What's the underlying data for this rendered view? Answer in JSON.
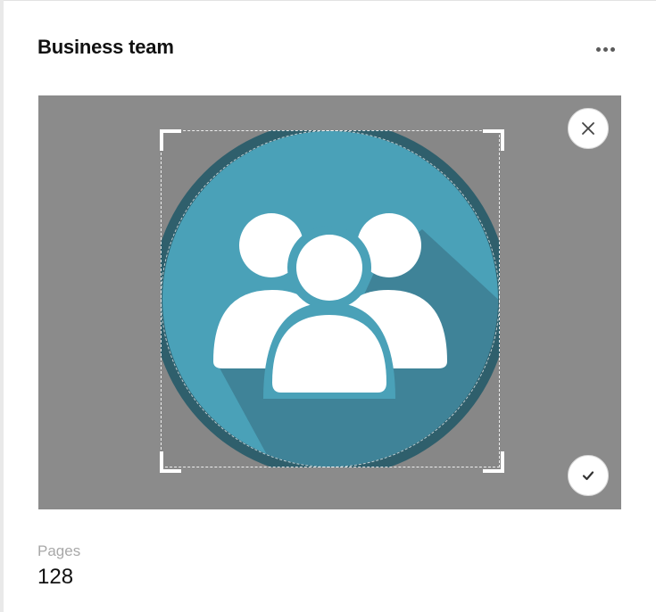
{
  "panel": {
    "title": "Business team",
    "more_icon": "more-horizontal-icon"
  },
  "editor": {
    "image": "team-group-icon",
    "close_icon": "close-icon",
    "confirm_icon": "check-icon",
    "colors": {
      "backdrop": "#8b8b8b",
      "circle": "#4aa1b8",
      "circle_rim": "#2f5f6c",
      "shadow": "#3f8398",
      "figure": "#ffffff"
    }
  },
  "details": {
    "pages_label": "Pages",
    "pages_value": "128"
  }
}
